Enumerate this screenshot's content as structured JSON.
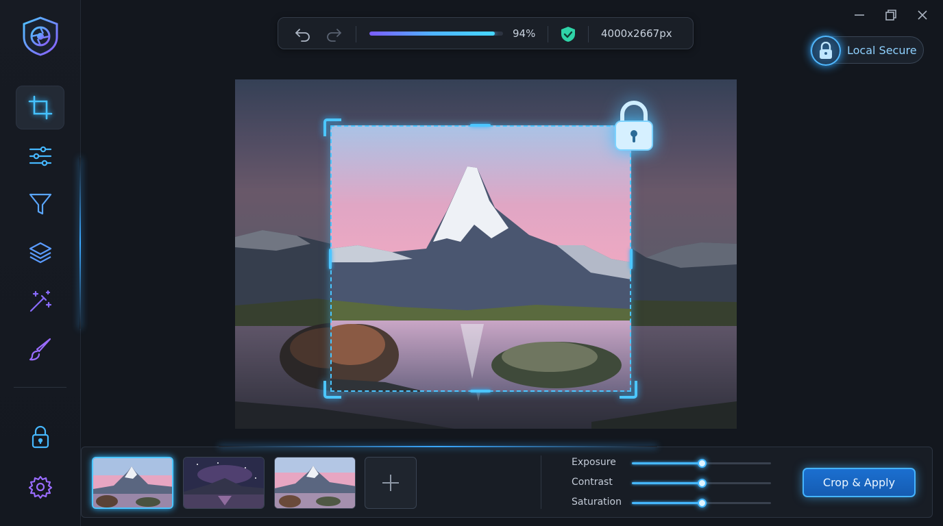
{
  "toolbar": {
    "progress_percent": 94,
    "progress_label": "94%",
    "dimensions": "4000x2667px"
  },
  "secure_badge": {
    "label": "Local Secure"
  },
  "sidebar": {
    "tools": [
      {
        "icon": "crop-icon",
        "active": true
      },
      {
        "icon": "sliders-icon"
      },
      {
        "icon": "filter-icon"
      },
      {
        "icon": "layers-icon"
      },
      {
        "icon": "magic-wand-icon"
      },
      {
        "icon": "brush-icon"
      }
    ],
    "bottom": [
      {
        "icon": "lock-icon"
      },
      {
        "icon": "gear-icon"
      }
    ]
  },
  "adjustments": [
    {
      "label": "Exposure",
      "value": 0.5
    },
    {
      "label": "Contrast",
      "value": 0.5
    },
    {
      "label": "Saturation",
      "value": 0.5
    }
  ],
  "apply_button": {
    "label": "Crop & Apply"
  },
  "colors": {
    "accent": "#4cc6ff",
    "button": "#1b6fd0",
    "badge_text": "#8fd1ff"
  }
}
